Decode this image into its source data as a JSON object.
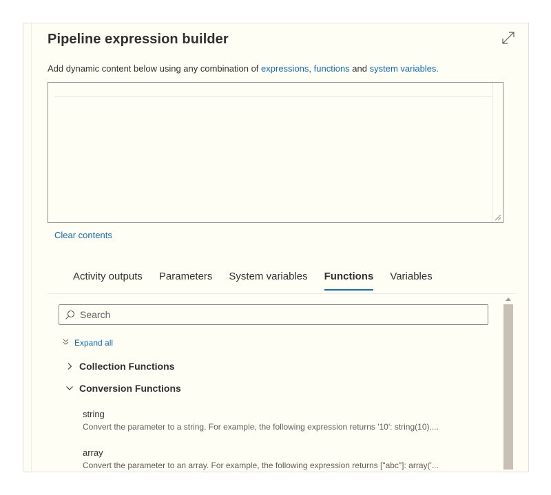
{
  "dialog": {
    "title": "Pipeline expression builder",
    "subtitle_prefix": "Add dynamic content below using any combination of ",
    "link_expressions": "expressions,",
    "link_functions": "functions",
    "subtitle_and": " and ",
    "link_system_variables": "system variables.",
    "editor_value": "",
    "clear_label": "Clear contents"
  },
  "tabs": [
    {
      "label": "Activity outputs",
      "active": false
    },
    {
      "label": "Parameters",
      "active": false
    },
    {
      "label": "System variables",
      "active": false
    },
    {
      "label": "Functions",
      "active": true
    },
    {
      "label": "Variables",
      "active": false
    }
  ],
  "functions_panel": {
    "search_placeholder": "Search",
    "expand_all_label": "Expand all",
    "groups": [
      {
        "label": "Collection Functions",
        "expanded": false
      },
      {
        "label": "Conversion Functions",
        "expanded": true
      }
    ],
    "items": [
      {
        "name": "string",
        "description": "Convert the parameter to a string. For example, the following expression returns '10': string(10)...."
      },
      {
        "name": "array",
        "description": "Convert the parameter to an array. For example, the following expression returns [\"abc\"]: array('..."
      }
    ]
  },
  "icons": {
    "expand": "expand-diagonal-icon",
    "search": "search-icon",
    "expand_all": "double-chevron-down-icon",
    "collapsed": "chevron-right-icon",
    "expanded": "chevron-down-icon"
  },
  "colors": {
    "background": "#fffef5",
    "link": "#0f6cbd",
    "text": "#323130",
    "active_tab_underline": "#0f6cbd",
    "scroll_thumb": "#c8c0b5"
  }
}
